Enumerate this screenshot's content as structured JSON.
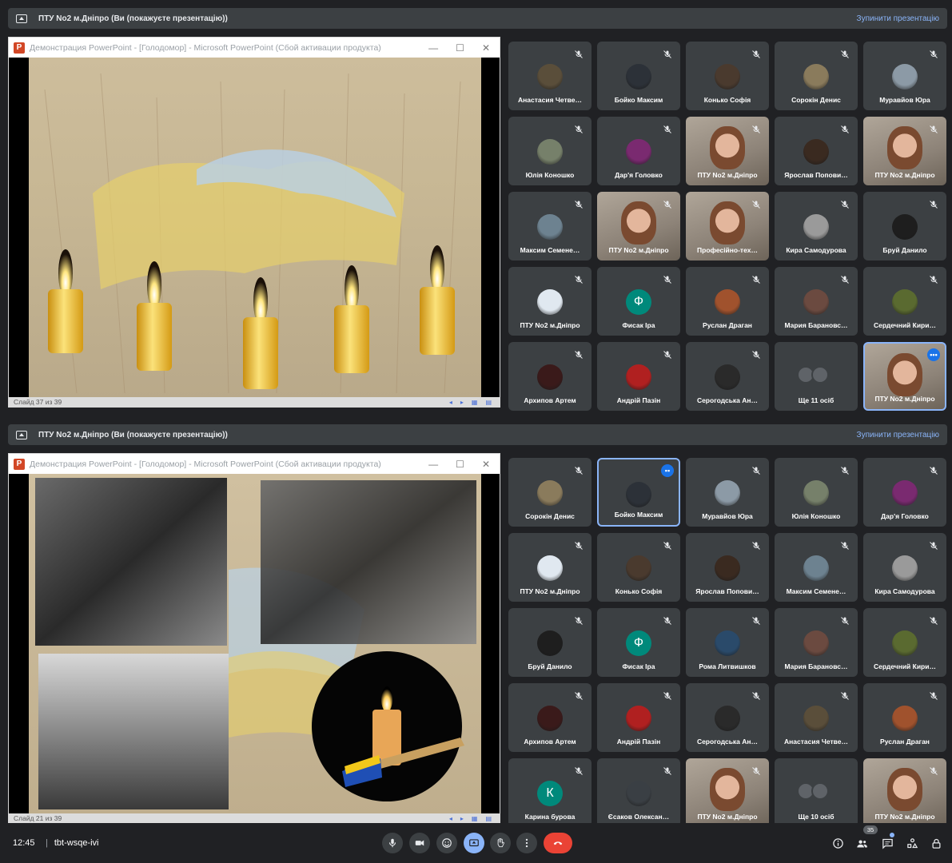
{
  "top": {
    "banner": {
      "title": "ПТУ No2 м.Дніпро (Ви (покажуєте презентацію))",
      "stop": "Зупинити презентацію"
    },
    "ppt": {
      "title": "Демонстрация PowerPoint - [Голодомор] - Microsoft PowerPoint (Сбой активации продукта)",
      "status": "Слайд 37 из 39"
    },
    "tiles": [
      {
        "name": "Анастасия Четве…",
        "color": "#5a4e3a",
        "kind": "avatar"
      },
      {
        "name": "Бойко Максим",
        "color": "#2c3138",
        "kind": "avatar"
      },
      {
        "name": "Конько Софія",
        "color": "#4a3a2e",
        "kind": "avatar"
      },
      {
        "name": "Сорокін Денис",
        "color": "#8a7b5c",
        "kind": "avatar"
      },
      {
        "name": "Муравйов Юра",
        "color": "#8c9aa6",
        "kind": "avatar"
      },
      {
        "name": "Юлія Коношко",
        "color": "#76806a",
        "kind": "avatar"
      },
      {
        "name": "Дар'я Головко",
        "color": "#7a2a70",
        "kind": "avatar"
      },
      {
        "name": "ПТУ No2 м.Дніпро",
        "kind": "video"
      },
      {
        "name": "Ярослав Попови…",
        "color": "#3a2a20",
        "kind": "avatar"
      },
      {
        "name": "ПТУ No2 м.Дніпро",
        "kind": "video"
      },
      {
        "name": "Максим Семене…",
        "color": "#6d8290",
        "kind": "avatar"
      },
      {
        "name": "ПТУ No2 м.Дніпро",
        "kind": "video"
      },
      {
        "name": "Професійно-тех…",
        "kind": "video"
      },
      {
        "name": "Кира Самодурова",
        "color": "#9a9a9a",
        "kind": "avatar"
      },
      {
        "name": "Бруй Данило",
        "color": "#1e1e1e",
        "kind": "avatar"
      },
      {
        "name": "ПТУ No2 м.Дніпро",
        "color": "#e0e8f0",
        "kind": "avatar"
      },
      {
        "name": "Фисак Іра",
        "letter": "Ф",
        "color": "#00897b",
        "kind": "letter"
      },
      {
        "name": "Руслан Драган",
        "color": "#a0522d",
        "kind": "avatar"
      },
      {
        "name": "Мария Барановс…",
        "color": "#6b4a40",
        "kind": "avatar"
      },
      {
        "name": "Сердечний Кири…",
        "color": "#5a6a30",
        "kind": "avatar"
      },
      {
        "name": "Архипов Артем",
        "color": "#3a1a1a",
        "kind": "avatar"
      },
      {
        "name": "Андрій Пазін",
        "color": "#b02020",
        "kind": "avatar"
      },
      {
        "name": "Серогодська Ан…",
        "color": "#2a2a2a",
        "kind": "avatar"
      },
      {
        "name": "Ще 11 осіб",
        "kind": "more"
      },
      {
        "name": "ПТУ No2 м.Дніпро",
        "kind": "video",
        "active": true
      }
    ]
  },
  "bottom": {
    "banner": {
      "title": "ПТУ No2 м.Дніпро (Ви (покажуєте презентацію))",
      "stop": "Зупинити презентацію"
    },
    "ppt": {
      "title": "Демонстрация PowerPoint - [Голодомор] - Microsoft PowerPoint (Сбой активации продукта)",
      "status": "Слайд 21 из 39"
    },
    "tiles": [
      {
        "name": "Сорокін Денис",
        "color": "#8a7b5c",
        "kind": "avatar"
      },
      {
        "name": "Бойко Максим",
        "color": "#2c3138",
        "kind": "avatar",
        "active": true
      },
      {
        "name": "Муравйов Юра",
        "color": "#8c9aa6",
        "kind": "avatar"
      },
      {
        "name": "Юлія Коношко",
        "color": "#76806a",
        "kind": "avatar"
      },
      {
        "name": "Дар'я Головко",
        "color": "#7a2a70",
        "kind": "avatar"
      },
      {
        "name": "ПТУ No2 м.Дніпро",
        "color": "#e0e8f0",
        "kind": "avatar"
      },
      {
        "name": "Конько Софія",
        "color": "#4a3a2e",
        "kind": "avatar"
      },
      {
        "name": "Ярослав Попови…",
        "color": "#3a2a20",
        "kind": "avatar"
      },
      {
        "name": "Максим Семене…",
        "color": "#6d8290",
        "kind": "avatar"
      },
      {
        "name": "Кира Самодурова",
        "color": "#9a9a9a",
        "kind": "avatar"
      },
      {
        "name": "Бруй Данило",
        "color": "#1e1e1e",
        "kind": "avatar"
      },
      {
        "name": "Фисак Іра",
        "letter": "Ф",
        "color": "#00897b",
        "kind": "letter"
      },
      {
        "name": "Рома Литвишков",
        "color": "#2a4a6a",
        "kind": "avatar"
      },
      {
        "name": "Мария Барановс…",
        "color": "#6b4a40",
        "kind": "avatar"
      },
      {
        "name": "Сердечний Кири…",
        "color": "#5a6a30",
        "kind": "avatar"
      },
      {
        "name": "Архипов Артем",
        "color": "#3a1a1a",
        "kind": "avatar"
      },
      {
        "name": "Андрій Пазін",
        "color": "#b02020",
        "kind": "avatar"
      },
      {
        "name": "Серогодська Ан…",
        "color": "#2a2a2a",
        "kind": "avatar"
      },
      {
        "name": "Анастасия Четве…",
        "color": "#5a4e3a",
        "kind": "avatar"
      },
      {
        "name": "Руслан Драган",
        "color": "#a0522d",
        "kind": "avatar"
      },
      {
        "name": "Карина бурова",
        "letter": "К",
        "color": "#00897b",
        "kind": "letter"
      },
      {
        "name": "Єсаков Олексан…",
        "color": "#3a3f44",
        "kind": "avatar"
      },
      {
        "name": "ПТУ No2 м.Дніпро",
        "kind": "video"
      },
      {
        "name": "Ще 10 осіб",
        "kind": "more"
      },
      {
        "name": "ПТУ No2 м.Дніпро",
        "kind": "video"
      }
    ]
  },
  "bottombar": {
    "clock": "12:45",
    "meeting_code": "tbt-wsqe-ivi",
    "participants_count": "35",
    "icons": [
      "mic-icon",
      "camera-icon",
      "emoji-icon",
      "present-icon",
      "hand-icon",
      "more-icon",
      "end-call-icon",
      "info-icon",
      "people-icon",
      "chat-icon",
      "activities-icon",
      "lock-icon"
    ],
    "colors": {
      "end": "#ea4335",
      "accent": "#8ab4f8"
    }
  }
}
